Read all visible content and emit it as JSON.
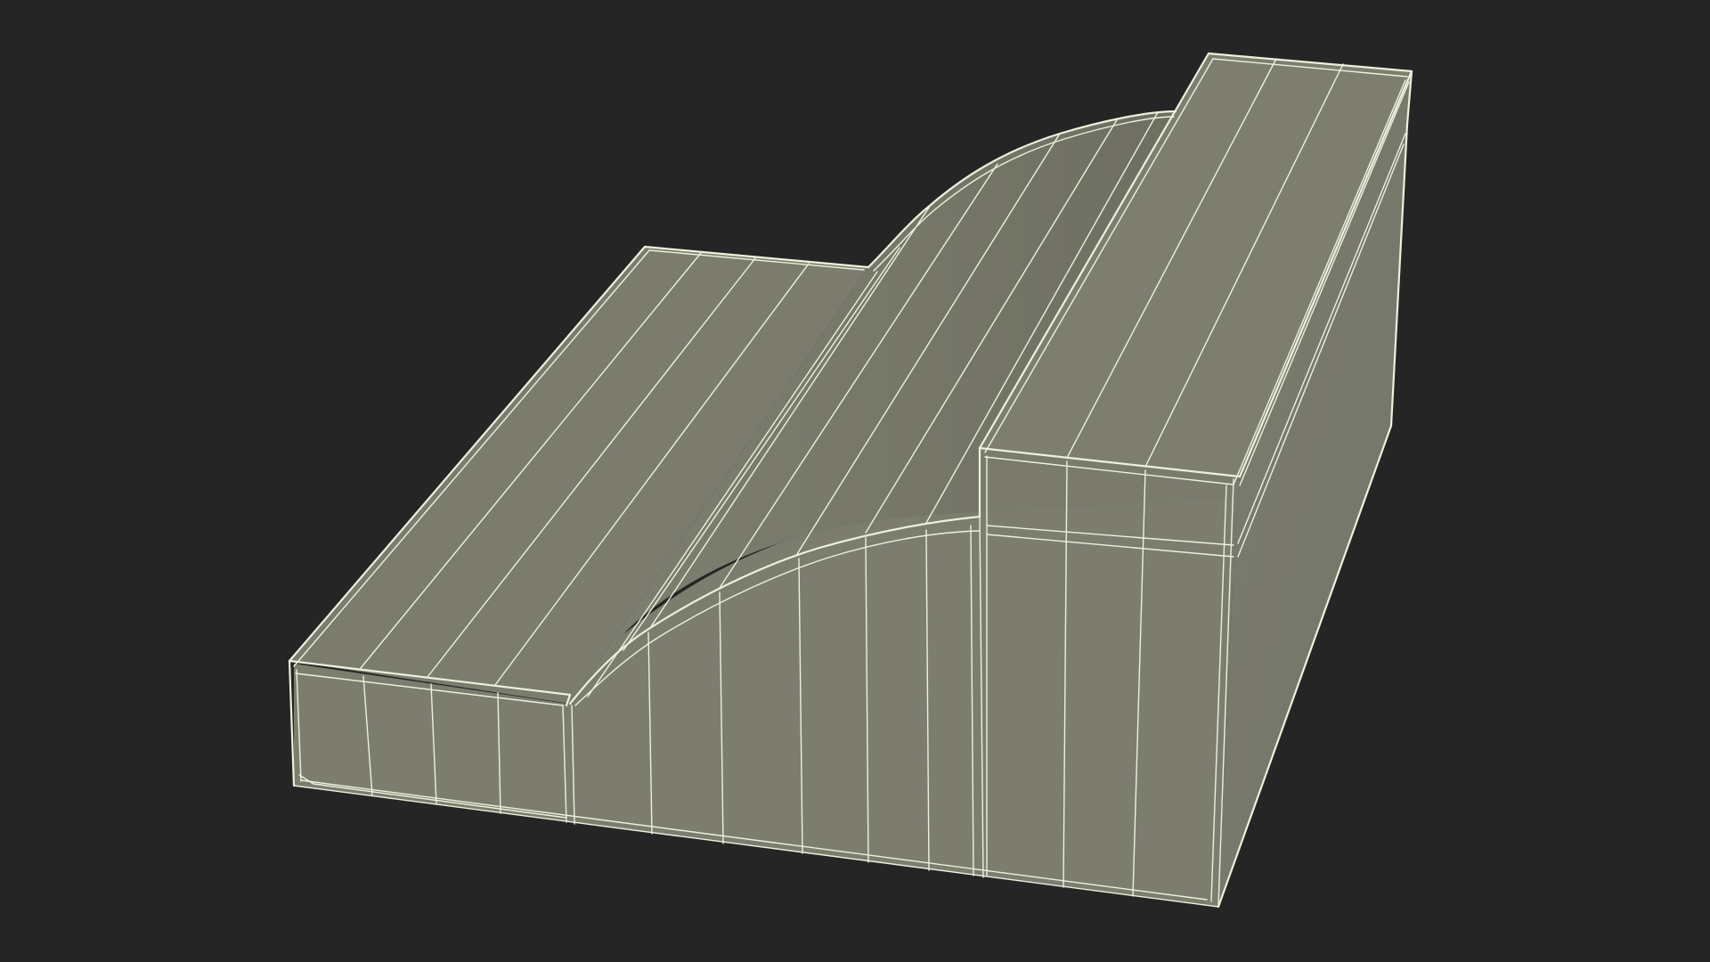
{
  "scene": {
    "background_color": "#252525",
    "surface_color": "#7d7e70",
    "surface_shade_color": "#6f7064",
    "wire_color": "#eef0dd"
  }
}
